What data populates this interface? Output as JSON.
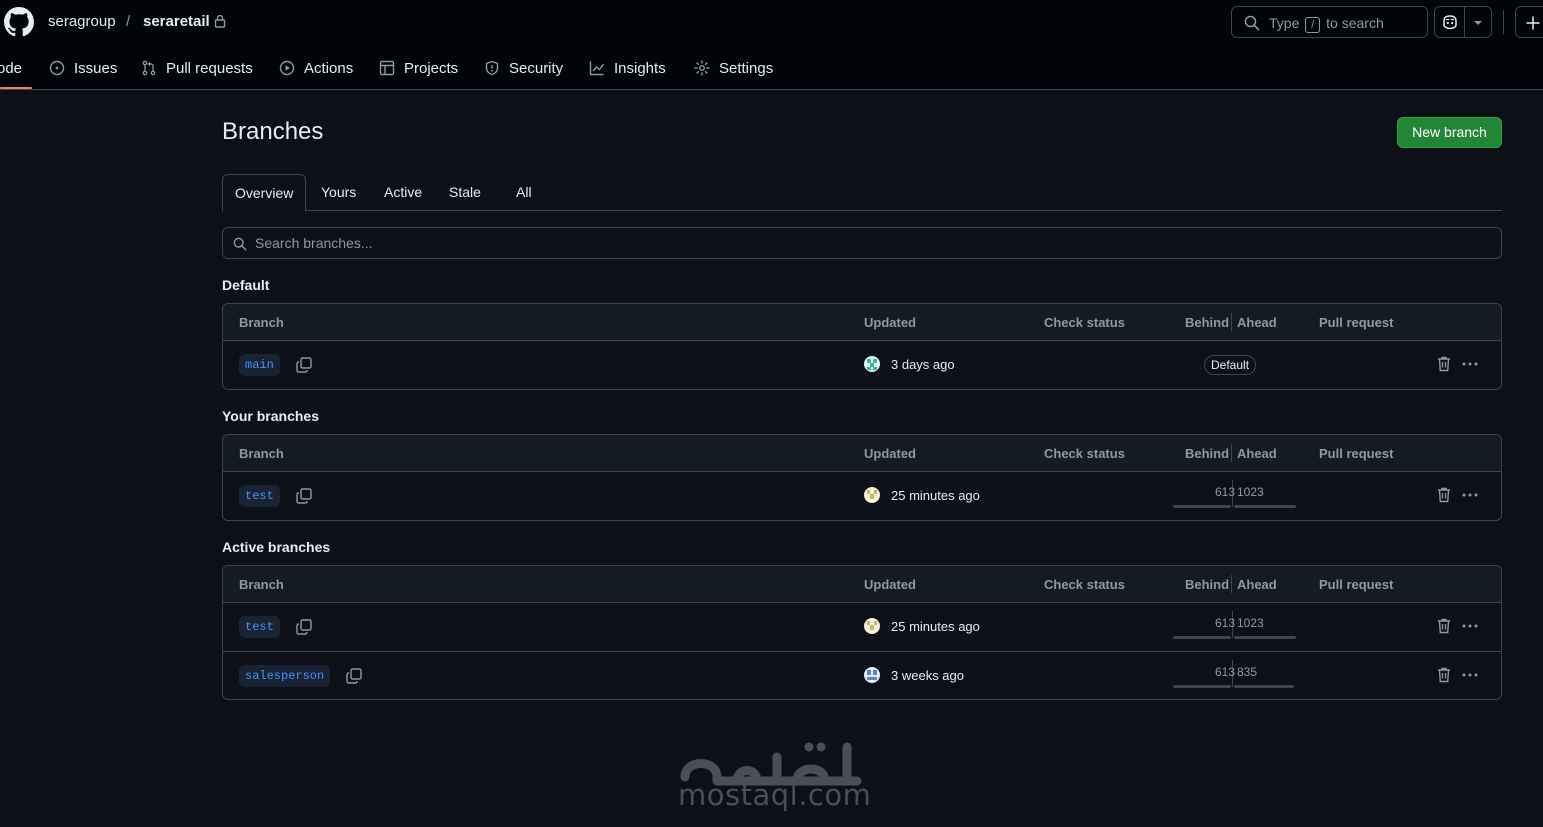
{
  "header": {
    "owner": "seragroup",
    "separator": "/",
    "repo": "seraretail",
    "search": {
      "before": "Type",
      "key": "/",
      "after": "to search"
    }
  },
  "nav": {
    "items": [
      {
        "label": "ode",
        "icon": "code-icon"
      },
      {
        "label": "Issues",
        "icon": "issue-icon"
      },
      {
        "label": "Pull requests",
        "icon": "pull-request-icon"
      },
      {
        "label": "Actions",
        "icon": "play-icon"
      },
      {
        "label": "Projects",
        "icon": "table-icon"
      },
      {
        "label": "Security",
        "icon": "shield-icon"
      },
      {
        "label": "Insights",
        "icon": "graph-icon"
      },
      {
        "label": "Settings",
        "icon": "gear-icon"
      }
    ],
    "active_color": "#f78166"
  },
  "page": {
    "title": "Branches",
    "new_branch_label": "New branch",
    "accent": "#238636"
  },
  "tabs": [
    "Overview",
    "Yours",
    "Active",
    "Stale",
    "All"
  ],
  "branch_search": {
    "placeholder": "Search branches..."
  },
  "columns": {
    "branch": "Branch",
    "updated": "Updated",
    "check_status": "Check status",
    "behind": "Behind",
    "ahead": "Ahead",
    "pull_request": "Pull request"
  },
  "sections": [
    {
      "title": "Default",
      "rows": [
        {
          "branch": "main",
          "updated": "3 days ago",
          "badge": "Default"
        }
      ]
    },
    {
      "title": "Your branches",
      "rows": [
        {
          "branch": "test",
          "updated": "25 minutes ago",
          "behind": "613",
          "ahead": "1023"
        }
      ]
    },
    {
      "title": "Active branches",
      "rows": [
        {
          "branch": "test",
          "updated": "25 minutes ago",
          "behind": "613",
          "ahead": "1023"
        },
        {
          "branch": "salesperson",
          "updated": "3 weeks ago",
          "behind": "613",
          "ahead": "835"
        }
      ]
    }
  ],
  "watermark": {
    "text": "mostaql.com"
  }
}
